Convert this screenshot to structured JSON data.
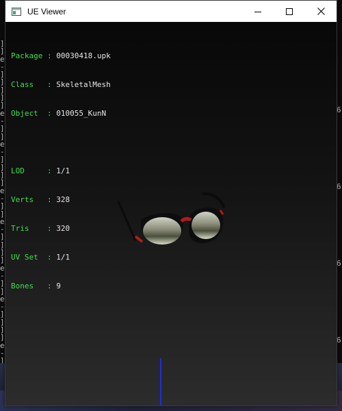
{
  "window": {
    "title": "UE Viewer",
    "icon": "app-window-icon"
  },
  "controls": {
    "minimize_icon": "minimize-icon",
    "maximize_icon": "maximize-icon",
    "close_icon": "close-icon"
  },
  "info": {
    "package": {
      "label": "Package",
      "value": "00030418.upk"
    },
    "class": {
      "label": "Class  ",
      "value": "SkeletalMesh"
    },
    "object": {
      "label": "Object ",
      "value": "010055_KunN"
    },
    "lod": {
      "label": "LOD    ",
      "value": "1/1"
    },
    "verts": {
      "label": "Verts  ",
      "value": "328"
    },
    "tris": {
      "label": "Tris   ",
      "value": "320"
    },
    "uvset": {
      "label": "UV Set ",
      "value": "1/1"
    },
    "bones": {
      "label": "Bones  ",
      "value": "9"
    },
    "separator": ":"
  },
  "background_console": {
    "left_chars": [
      "]",
      "]",
      "e",
      "-",
      "]",
      "]",
      "]",
      "]",
      "]",
      "e",
      "-",
      "]",
      "]",
      "e",
      "-",
      "]",
      "]",
      "]",
      "]",
      "e",
      "-",
      "]",
      "]",
      "e",
      "-",
      "]",
      "]",
      "]",
      "]",
      "e",
      "-",
      "]",
      "]",
      "e",
      "-",
      "]",
      "]",
      "]",
      "]",
      "e",
      "-",
      "]"
    ],
    "right_chars": [
      "6",
      "6",
      "6",
      "6"
    ]
  },
  "colors": {
    "label": "#3ee04a",
    "value": "#e6e6e6",
    "axis": "#1f2fd8",
    "frame_red": "#b31a1a"
  }
}
